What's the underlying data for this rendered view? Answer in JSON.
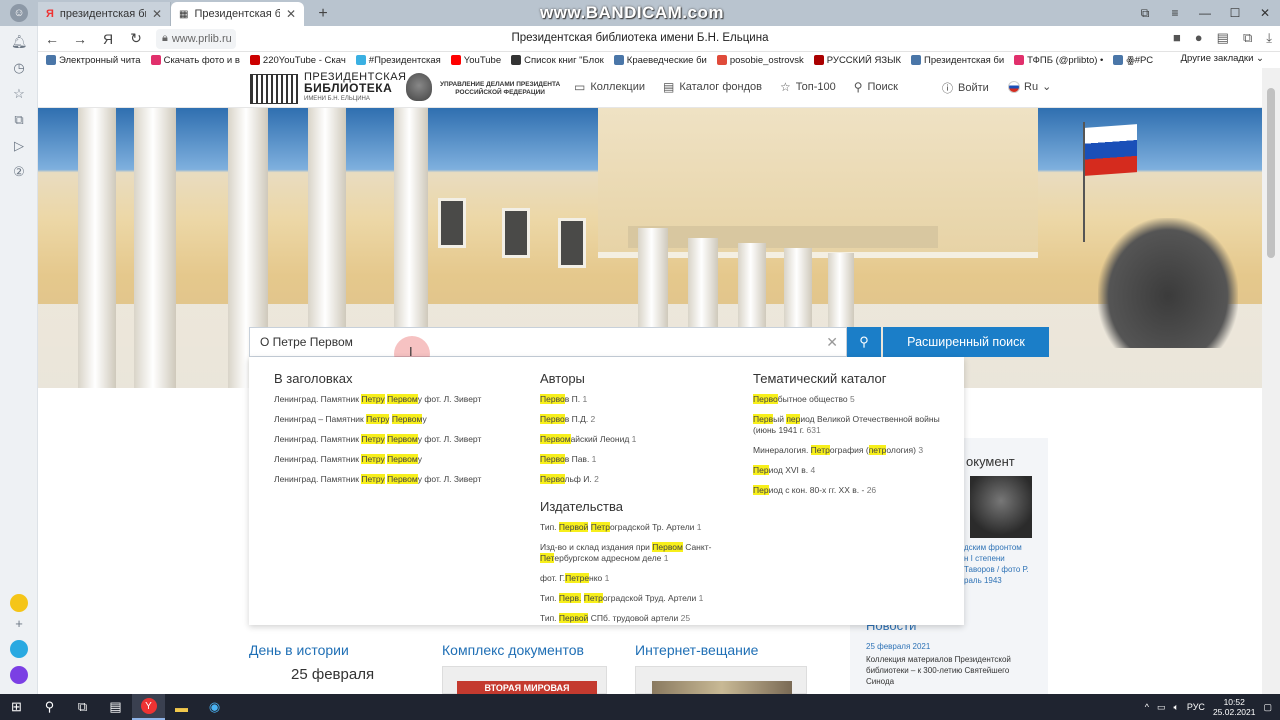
{
  "browser": {
    "tabs": [
      {
        "title": "президентская библиотека",
        "active": false
      },
      {
        "title": "Президентская библиотека",
        "active": true
      }
    ],
    "watermark": "www.BANDICAM.com",
    "url": "www.prlib.ru",
    "page_title": "Президентская библиотека имени Б.Н. Ельцина",
    "bookmarks": [
      {
        "label": "Электронный чита",
        "color": "#4a76a8"
      },
      {
        "label": "Скачать фото и в",
        "color": "#e1306c"
      },
      {
        "label": "220YouTube - Скач",
        "color": "#c00"
      },
      {
        "label": "#Президентская",
        "color": "#3ab0e2"
      },
      {
        "label": "YouTube",
        "color": "#ff0000"
      },
      {
        "label": "Список книг \"Блок",
        "color": "#333"
      },
      {
        "label": "Краеведческие би",
        "color": "#4a76a8"
      },
      {
        "label": "posobie_ostrovsk",
        "color": "#e04b3a"
      },
      {
        "label": "РУССКИЙ ЯЗЫК",
        "color": "#a00"
      },
      {
        "label": "Президентская би",
        "color": "#4a76a8"
      },
      {
        "label": "ТФПБ (@prlibto) •",
        "color": "#e1306c"
      },
      {
        "label": "ꙮ#РС",
        "color": "#4a76a8"
      }
    ],
    "other_bookmarks": "Другие закладки"
  },
  "site": {
    "logo_line1": "ПРЕЗИДЕНТСКАЯ",
    "logo_line2": "БИБЛИОТЕКА",
    "logo_line3": "ИМЕНИ Б.Н. ЕЛЬЦИНА",
    "admin_line1": "УПРАВЛЕНИЕ ДЕЛАМИ ПРЕЗИДЕНТА",
    "admin_line2": "РОССИЙСКОЙ ФЕДЕРАЦИИ",
    "nav": [
      "Коллекции",
      "Каталог фондов",
      "Топ-100",
      "Поиск"
    ],
    "login": "Войти",
    "lang": "Ru"
  },
  "search": {
    "value": "О Петре Первом",
    "advanced_label": "Расширенный поиск"
  },
  "suggest": {
    "titles_heading": "В заголовках",
    "titles": [
      [
        {
          "t": "Ленинград. Памятник "
        },
        {
          "t": "Петру",
          "h": true
        },
        {
          "t": " "
        },
        {
          "t": "Первом",
          "h": true
        },
        {
          "t": "у фот. Л. Зиверт"
        }
      ],
      [
        {
          "t": "Ленинград – Памятник "
        },
        {
          "t": "Петру",
          "h": true
        },
        {
          "t": " "
        },
        {
          "t": "Первом",
          "h": true
        },
        {
          "t": "у"
        }
      ],
      [
        {
          "t": "Ленинград. Памятник "
        },
        {
          "t": "Петру",
          "h": true
        },
        {
          "t": " "
        },
        {
          "t": "Первом",
          "h": true
        },
        {
          "t": "у фот. Л. Зиверт"
        }
      ],
      [
        {
          "t": "Ленинград. Памятник "
        },
        {
          "t": "Петру",
          "h": true
        },
        {
          "t": " "
        },
        {
          "t": "Первом",
          "h": true
        },
        {
          "t": "у"
        }
      ],
      [
        {
          "t": "Ленинград. Памятник "
        },
        {
          "t": "Петру",
          "h": true
        },
        {
          "t": " "
        },
        {
          "t": "Первом",
          "h": true
        },
        {
          "t": "у фот. Л. Зиверт"
        }
      ]
    ],
    "authors_heading": "Авторы",
    "authors": [
      [
        {
          "t": "Перво",
          "h": true
        },
        {
          "t": "в П. "
        },
        {
          "t": "1",
          "c": true
        }
      ],
      [
        {
          "t": "Перво",
          "h": true
        },
        {
          "t": "в П.Д. "
        },
        {
          "t": "2",
          "c": true
        }
      ],
      [
        {
          "t": "Первом",
          "h": true
        },
        {
          "t": "айский Леонид "
        },
        {
          "t": "1",
          "c": true
        }
      ],
      [
        {
          "t": "Перво",
          "h": true
        },
        {
          "t": "в Пав. "
        },
        {
          "t": "1",
          "c": true
        }
      ],
      [
        {
          "t": "Перво",
          "h": true
        },
        {
          "t": "льф И. "
        },
        {
          "t": "2",
          "c": true
        }
      ]
    ],
    "publishers_heading": "Издательства",
    "publishers": [
      [
        {
          "t": "Тип. "
        },
        {
          "t": "Первой",
          "h": true
        },
        {
          "t": " "
        },
        {
          "t": "Петр",
          "h": true
        },
        {
          "t": "оградской Тр. Артели "
        },
        {
          "t": "1",
          "c": true
        }
      ],
      [
        {
          "t": "Изд-во и склад издания при "
        },
        {
          "t": "Первом",
          "h": true
        },
        {
          "t": " Санкт-"
        },
        {
          "t": "Пет",
          "h": true
        },
        {
          "t": "ербургском адресном деле "
        },
        {
          "t": "1",
          "c": true
        }
      ],
      [
        {
          "t": "фот. Г."
        },
        {
          "t": "Петре",
          "h": true
        },
        {
          "t": "нко "
        },
        {
          "t": "1",
          "c": true
        }
      ],
      [
        {
          "t": "Тип. "
        },
        {
          "t": "Перв.",
          "h": true
        },
        {
          "t": " "
        },
        {
          "t": "Петр",
          "h": true
        },
        {
          "t": "оградской Труд. Артели "
        },
        {
          "t": "1",
          "c": true
        }
      ],
      [
        {
          "t": "Тип. "
        },
        {
          "t": "Первой",
          "h": true
        },
        {
          "t": " СПб. трудовой артели "
        },
        {
          "t": "25",
          "c": true
        }
      ]
    ],
    "thematic_heading": "Тематический каталог",
    "thematic": [
      [
        {
          "t": "Перво",
          "h": true
        },
        {
          "t": "бытное общество "
        },
        {
          "t": "5",
          "c": true
        }
      ],
      [
        {
          "t": "Перв",
          "h": true
        },
        {
          "t": "ый "
        },
        {
          "t": "пер",
          "h": true
        },
        {
          "t": "иод Великой Отечественной войны (июнь 1941 г. "
        },
        {
          "t": "631",
          "c": true
        }
      ],
      [
        {
          "t": "Минералогия. "
        },
        {
          "t": "Петр",
          "h": true
        },
        {
          "t": "ография ("
        },
        {
          "t": "петр",
          "h": true
        },
        {
          "t": "ология) "
        },
        {
          "t": "3",
          "c": true
        }
      ],
      [
        {
          "t": "Пер",
          "h": true
        },
        {
          "t": "иод XVI в. "
        },
        {
          "t": "4",
          "c": true
        }
      ],
      [
        {
          "t": "Пер",
          "h": true
        },
        {
          "t": "иод с кон. 80-х гг. XX в. - "
        },
        {
          "t": "26",
          "c": true
        }
      ]
    ]
  },
  "sidebar_right": {
    "doc_title": "окумент",
    "caption": "дским фронтом\nн I степени\nТаворов / фото Р.\nраль 1943",
    "news_heading": "Новости",
    "news_date": "25 февраля 2021",
    "news_text": "Коллекция материалов Президентской библиотеки – к 300-летию Святейшего Синода"
  },
  "bottom": {
    "history": "День в истории",
    "history_date": "25 февраля",
    "complex": "Комплекс документов",
    "complex_thumb": "ВТОРАЯ МИРОВАЯ",
    "broadcast": "Интернет-вещание"
  },
  "taskbar": {
    "lang": "РУС",
    "time": "10:52",
    "date": "25.02.2021"
  }
}
